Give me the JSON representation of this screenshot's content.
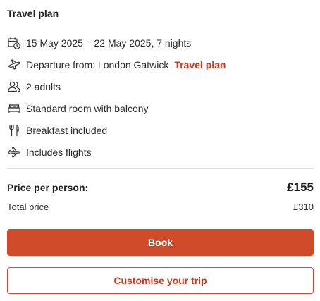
{
  "panel": {
    "title": "Travel plan"
  },
  "details": [
    {
      "icon": "calendar-clock-icon",
      "text": "15 May 2025 – 22 May 2025, 7 nights"
    },
    {
      "icon": "plane-departure-icon",
      "text": "Departure from: London Gatwick",
      "link": "Travel plan"
    },
    {
      "icon": "users-icon",
      "text": "2 adults"
    },
    {
      "icon": "bed-icon",
      "text": "Standard room with balcony"
    },
    {
      "icon": "cutlery-icon",
      "text": "Breakfast included"
    },
    {
      "icon": "plane-icon",
      "text": "Includes flights"
    }
  ],
  "price": {
    "per_person_label": "Price per person:",
    "per_person_value": "£155",
    "total_label": "Total price",
    "total_value": "£310"
  },
  "buttons": {
    "book": "Book",
    "customise": "Customise your trip"
  },
  "colors": {
    "accent": "#cf4a28",
    "link": "#d03a1c",
    "divider": "#dedede"
  }
}
